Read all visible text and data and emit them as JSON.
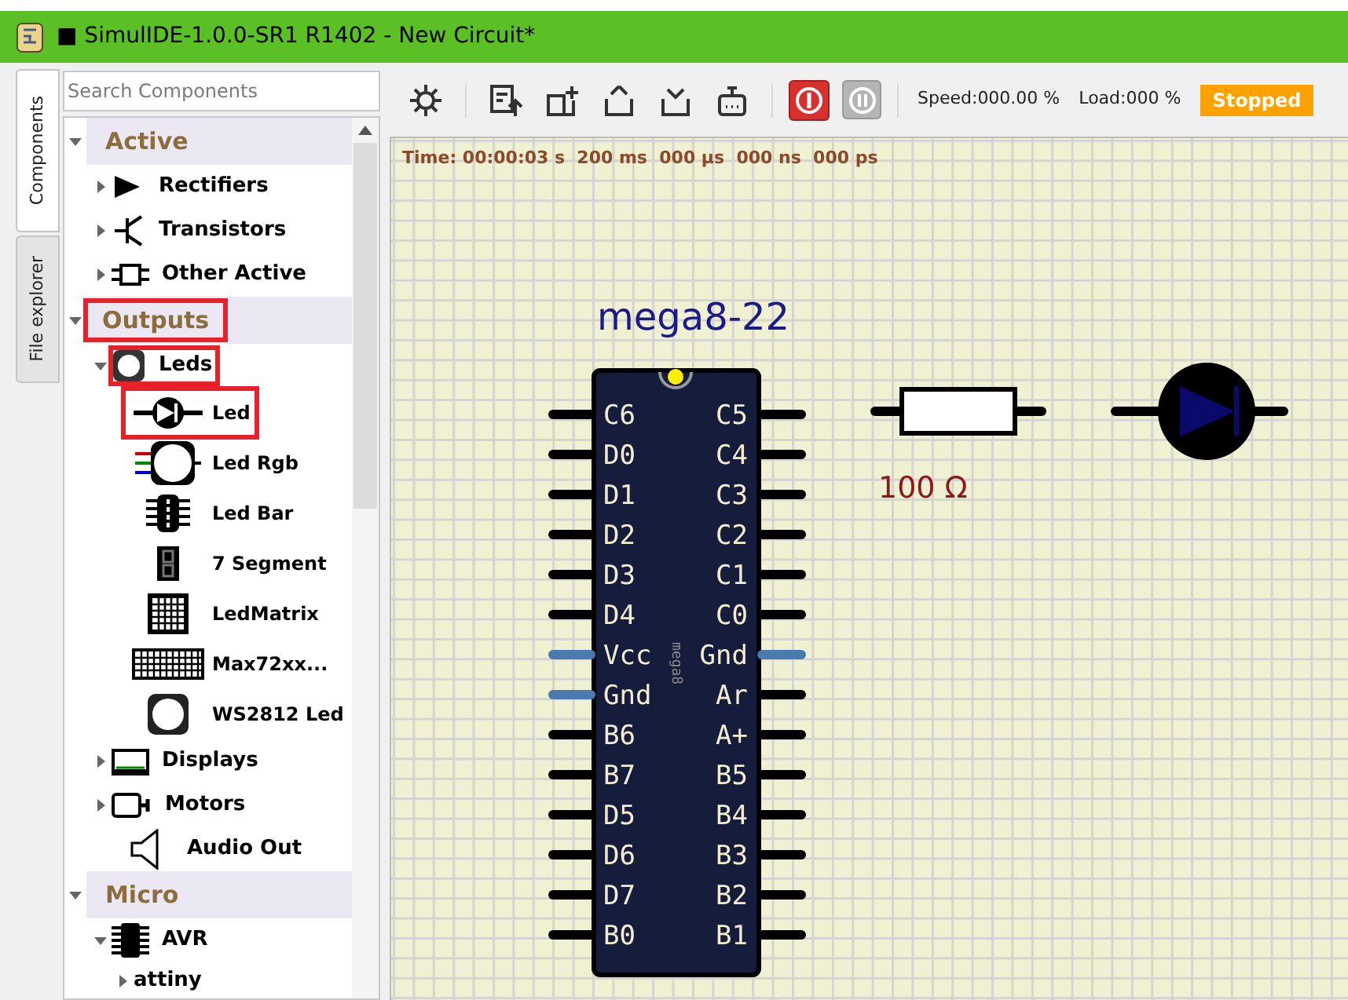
{
  "window": {
    "title": "■ SimulIDE-1.0.0-SR1 R1402 - New Circuit*"
  },
  "side_tabs": [
    {
      "label": "Components",
      "selected": true
    },
    {
      "label": "File explorer",
      "selected": false
    }
  ],
  "search": {
    "placeholder": "Search Components"
  },
  "tree": [
    {
      "label": "Active",
      "kind": "category",
      "expanded": true,
      "highlighted": false,
      "children": [
        {
          "label": "Rectifiers",
          "kind": "group",
          "expanded": false,
          "highlighted": false
        },
        {
          "label": "Transistors",
          "kind": "group",
          "expanded": false,
          "highlighted": false
        },
        {
          "label": "Other Active",
          "kind": "group",
          "expanded": false,
          "highlighted": false
        }
      ]
    },
    {
      "label": "Outputs",
      "kind": "category",
      "expanded": true,
      "highlighted": true,
      "children": [
        {
          "label": "Leds",
          "kind": "group",
          "expanded": true,
          "highlighted": true,
          "children": [
            {
              "label": "Led",
              "kind": "item",
              "highlighted": true
            },
            {
              "label": "Led Rgb",
              "kind": "item",
              "highlighted": false
            },
            {
              "label": "Led Bar",
              "kind": "item",
              "highlighted": false
            },
            {
              "label": "7 Segment",
              "kind": "item",
              "highlighted": false
            },
            {
              "label": "LedMatrix",
              "kind": "item",
              "highlighted": false
            },
            {
              "label": "Max72xx...",
              "kind": "item",
              "highlighted": false
            },
            {
              "label": "WS2812 Led",
              "kind": "item",
              "highlighted": false
            }
          ]
        },
        {
          "label": "Displays",
          "kind": "group",
          "expanded": false,
          "highlighted": false
        },
        {
          "label": "Motors",
          "kind": "group",
          "expanded": false,
          "highlighted": false
        },
        {
          "label": "Audio Out",
          "kind": "leaf",
          "highlighted": false
        }
      ]
    },
    {
      "label": "Micro",
      "kind": "category",
      "expanded": true,
      "highlighted": false,
      "children": [
        {
          "label": "AVR",
          "kind": "group",
          "expanded": true,
          "highlighted": false,
          "children": [
            {
              "label": "attiny",
              "kind": "subgroup",
              "expanded": false,
              "highlighted": false
            }
          ]
        }
      ]
    }
  ],
  "toolbar": {
    "speed": "Speed:000.00 %",
    "load": "Load:000 %",
    "status": "Stopped"
  },
  "canvas": {
    "time": "Time: 00:00:03 s  200 ms  000 µs  000 ns  000 ps",
    "chip": {
      "name": "mega8-22",
      "model": "mega8",
      "left_pins": [
        {
          "label": "C6",
          "kind": "io"
        },
        {
          "label": "D0",
          "kind": "io"
        },
        {
          "label": "D1",
          "kind": "io"
        },
        {
          "label": "D2",
          "kind": "io"
        },
        {
          "label": "D3",
          "kind": "io"
        },
        {
          "label": "D4",
          "kind": "io"
        },
        {
          "label": "Vcc",
          "kind": "power"
        },
        {
          "label": "Gnd",
          "kind": "power"
        },
        {
          "label": "B6",
          "kind": "io"
        },
        {
          "label": "B7",
          "kind": "io"
        },
        {
          "label": "D5",
          "kind": "io"
        },
        {
          "label": "D6",
          "kind": "io"
        },
        {
          "label": "D7",
          "kind": "io"
        },
        {
          "label": "B0",
          "kind": "io"
        }
      ],
      "right_pins": [
        {
          "label": "C5",
          "kind": "io"
        },
        {
          "label": "C4",
          "kind": "io"
        },
        {
          "label": "C3",
          "kind": "io"
        },
        {
          "label": "C2",
          "kind": "io"
        },
        {
          "label": "C1",
          "kind": "io"
        },
        {
          "label": "C0",
          "kind": "io"
        },
        {
          "label": "Gnd",
          "kind": "power"
        },
        {
          "label": "Ar",
          "kind": "io"
        },
        {
          "label": "A+",
          "kind": "io"
        },
        {
          "label": "B5",
          "kind": "io"
        },
        {
          "label": "B4",
          "kind": "io"
        },
        {
          "label": "B3",
          "kind": "io"
        },
        {
          "label": "B2",
          "kind": "io"
        },
        {
          "label": "B1",
          "kind": "io"
        }
      ]
    },
    "resistor": {
      "value": "100 Ω"
    }
  }
}
